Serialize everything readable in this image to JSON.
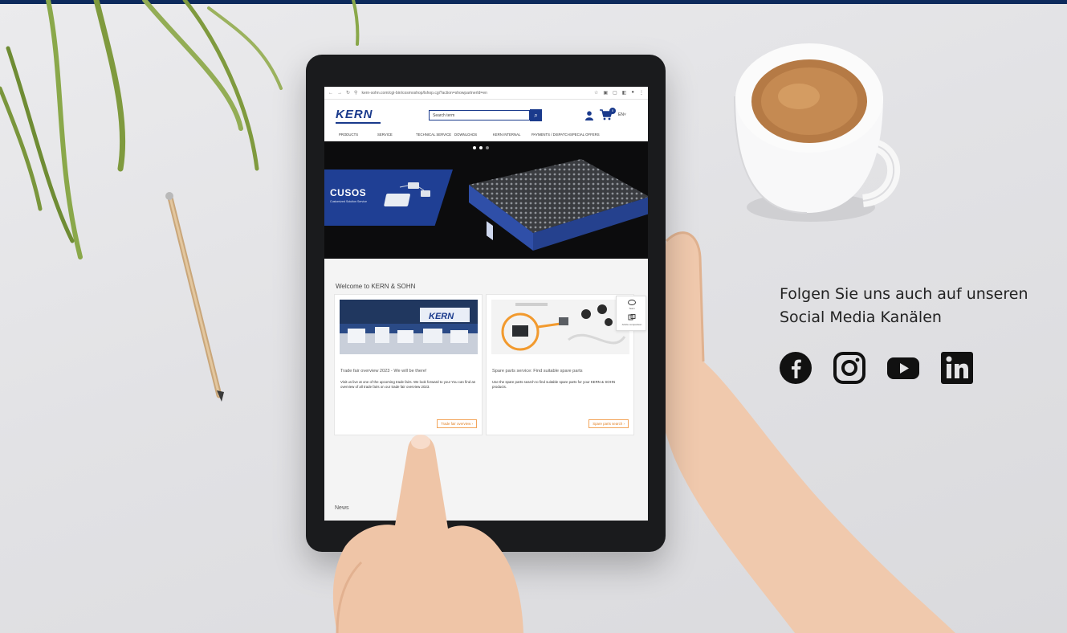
{
  "browser": {
    "url": "kern-sohn.com/cgi-bin/cosmoshop/lshop.cgi?action=showpartnerId=en"
  },
  "shop": {
    "logo_text": "KERN",
    "search_placeholder": "Search term",
    "cart_count": "0",
    "language": "EN",
    "nav": [
      {
        "label": "Products"
      },
      {
        "label": "Service"
      },
      {
        "label": "Technical Service"
      },
      {
        "label": "Downloads"
      },
      {
        "label": "KERN Internal"
      },
      {
        "label": "Payments / Dispatch"
      },
      {
        "label": "Special Offers"
      }
    ],
    "hero": {
      "title": "CUSOS",
      "subtitle": "Customized Solution Service"
    },
    "welcome_heading": "Welcome to KERN & SOHN",
    "cards": [
      {
        "title": "Trade fair overview 2023 - We will be there!",
        "text": "Visit us live at one of the upcoming trade fairs. We look forward to you! You can find an overview of all trade fairs on our trade fair overview 2023.",
        "button": "Trade fair overview"
      },
      {
        "title": "Spare parts service: Find suitable spare parts",
        "text": "Use the spare parts search to find suitable spare parts for your KERN & SOHN products.",
        "button": "Spare parts search"
      }
    ],
    "widget": {
      "item1": "Team",
      "item2": "Article comparison"
    },
    "news_heading": "News"
  },
  "social": {
    "line1": "Folgen Sie uns auch auf unseren",
    "line2": "Social Media Kanälen",
    "icons": [
      "facebook-icon",
      "instagram-icon",
      "youtube-icon",
      "linkedin-icon"
    ]
  },
  "colors": {
    "brand_blue": "#1a3a8c",
    "accent_orange": "#e07d1f",
    "top_bar": "#0d2a5c"
  }
}
